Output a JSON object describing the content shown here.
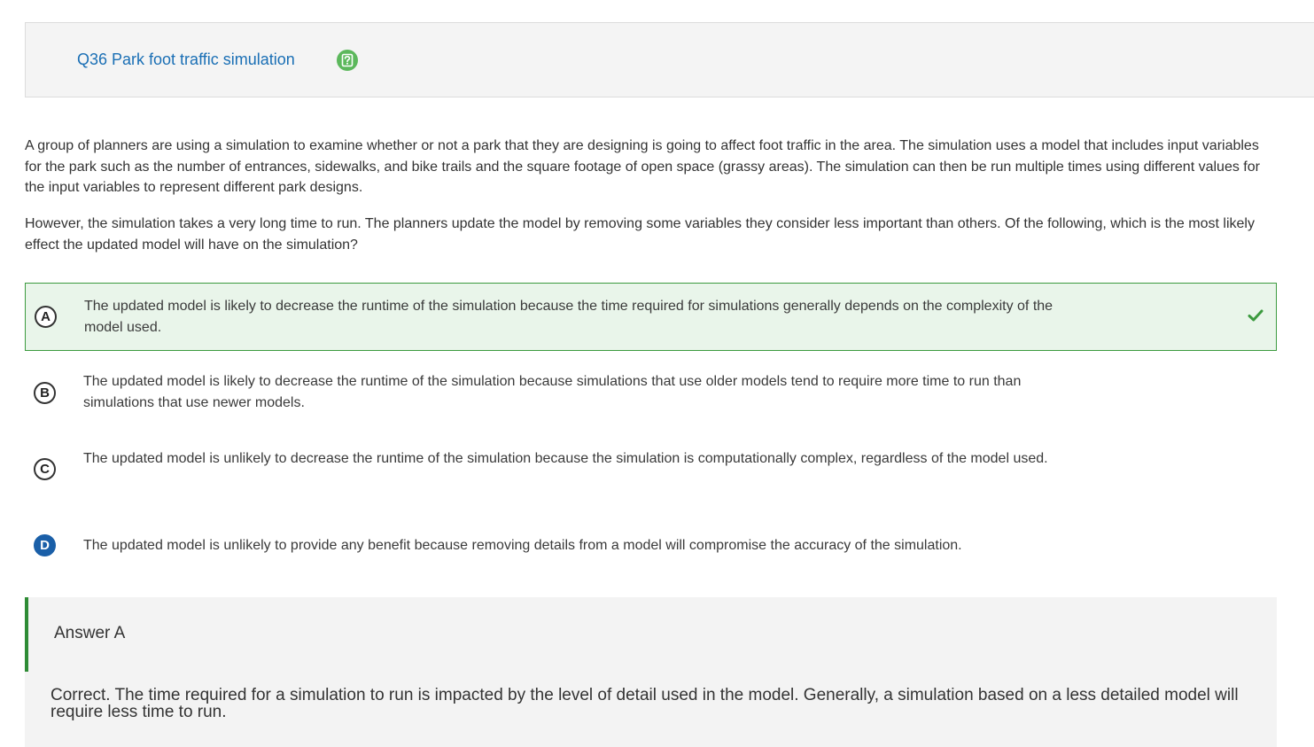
{
  "question": {
    "title": "Q36 Park foot traffic simulation",
    "help_icon": "question-mark-icon",
    "stem_paragraphs": [
      "A group of planners are using a simulation to examine whether or not a park that they are designing is going to affect foot traffic in the area. The simulation uses a model that includes input variables for the park such as the number of entrances, sidewalks, and bike trails and the square footage of open space (grassy areas). The simulation can then be run multiple times using different values for the input variables to represent different park designs.",
      "However, the simulation takes a very long time to run. The planners update the model by removing some variables they consider less important than others. Of the following, which is the most likely effect the updated model will have on the simulation?"
    ]
  },
  "options": [
    {
      "letter": "A",
      "text": "The updated model is likely to decrease the runtime of the simulation because the time required for simulations generally depends on the complexity of the model used.",
      "correct": true,
      "selected": false
    },
    {
      "letter": "B",
      "text": "The updated model is likely to decrease the runtime of the simulation because simulations that use older models tend to require more time to run than simulations that use newer models.",
      "correct": false,
      "selected": false
    },
    {
      "letter": "C",
      "text": "The updated model is unlikely to decrease the runtime of the simulation because the simulation is computationally complex, regardless of the model used.",
      "correct": false,
      "selected": false
    },
    {
      "letter": "D",
      "text": "The updated model is unlikely to provide any benefit because removing details from a model will compromise the accuracy of the simulation.",
      "correct": false,
      "selected": true
    }
  ],
  "answer": {
    "label": "Answer A",
    "explanation": "Correct. The time required for a simulation to run is impacted by the level of detail used in the model. Generally, a simulation based on a less detailed model will require less time to run."
  },
  "colors": {
    "title": "#1a6fb5",
    "help_icon": "#5cb85c",
    "correct_border": "#3c9a3f",
    "correct_bg": "#e9f5ea",
    "selected_letter": "#1a5fa8",
    "answer_bar": "#2e8b35"
  }
}
